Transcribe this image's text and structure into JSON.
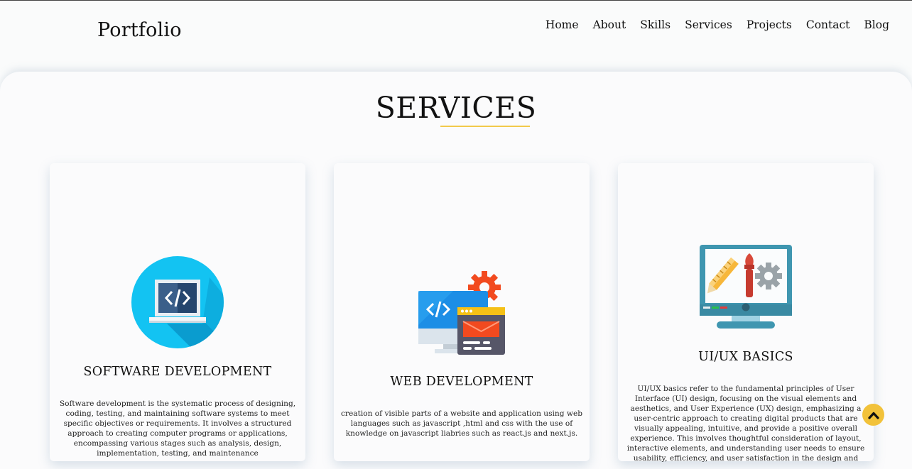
{
  "header": {
    "logo": "Portfolio",
    "nav": [
      "Home",
      "About",
      "Skills",
      "Services",
      "Projects",
      "Contact",
      "Blog"
    ]
  },
  "section": {
    "title": "SERVICES"
  },
  "cards": [
    {
      "title": "SOFTWARE DEVELOPMENT",
      "icon": "laptop-code-icon",
      "text": "Software development is the systematic process of designing, coding, testing, and maintaining software systems to meet specific objectives or requirements. It involves a structured approach to creating computer programs or applications, encompassing various stages such as analysis, design, implementation, testing, and maintenance"
    },
    {
      "title": "WEB DEVELOPMENT",
      "icon": "web-development-icon",
      "text": "creation of visible parts of a website and application using web languages such as javascript ,html and css with the use of knowledge on javascript liabries such as react.js and next.js."
    },
    {
      "title": "UI/UX BASICS",
      "icon": "design-monitor-icon",
      "text": "UI/UX basics refer to the fundamental principles of User Interface (UI) design, focusing on the visual elements and aesthetics, and User Experience (UX) design, emphasizing a user-centric approach to creating digital products that are visually appealing, intuitive, and provide a positive overall experience. This involves thoughtful consideration of layout, interactive elements, and understanding user needs to ensure usability, efficiency, and user satisfaction in the design and"
    }
  ],
  "colors": {
    "accent": "#f2c94c",
    "scroll_button": "#f2c23a"
  },
  "scroll_top_icon": "chevron-up-icon"
}
